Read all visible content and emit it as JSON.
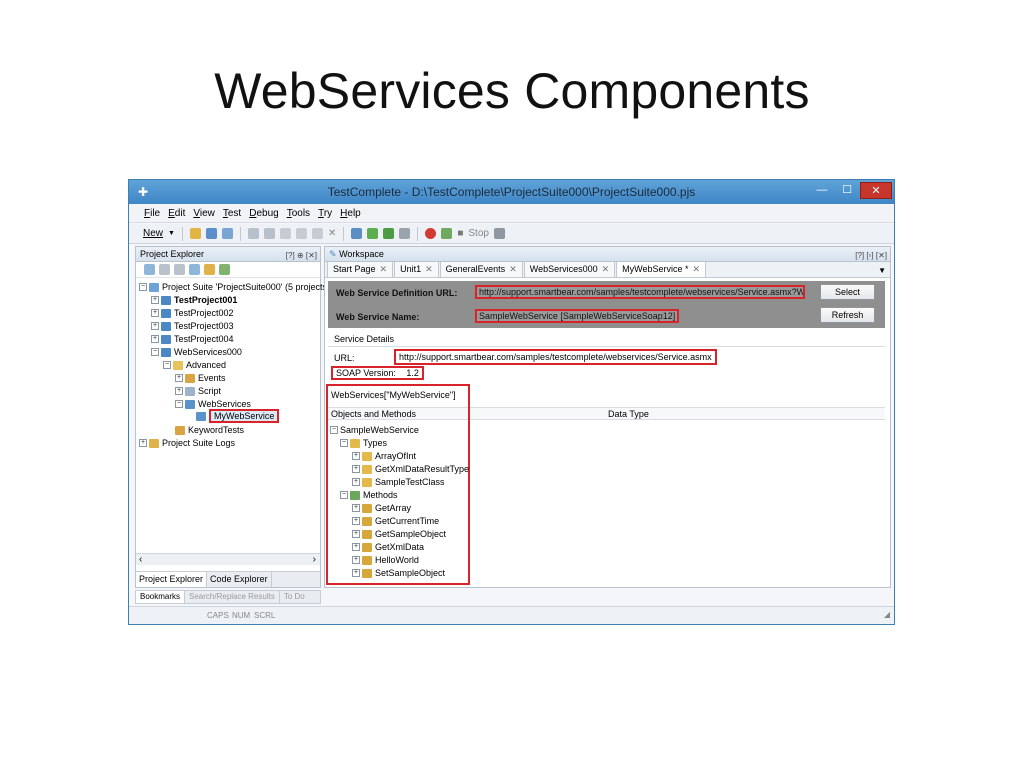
{
  "slide": {
    "title": "WebServices Components"
  },
  "window": {
    "title": "TestComplete - D:\\TestComplete\\ProjectSuite000\\ProjectSuite000.pjs",
    "min": "—",
    "max": "☐",
    "close": "✕"
  },
  "menu": [
    "File",
    "Edit",
    "View",
    "Test",
    "Debug",
    "Tools",
    "Try",
    "Help"
  ],
  "toolbar": {
    "new_label": "New",
    "stop_label": "Stop"
  },
  "project_explorer": {
    "title": "Project Explorer",
    "tree": [
      {
        "label": "Project Suite 'ProjectSuite000' (5 projects",
        "bold": false
      },
      {
        "label": "TestProject001",
        "bold": true
      },
      {
        "label": "TestProject002",
        "bold": false
      },
      {
        "label": "TestProject003",
        "bold": false
      },
      {
        "label": "TestProject004",
        "bold": false
      },
      {
        "label": "WebServices000",
        "bold": false
      },
      {
        "label": "Advanced",
        "bold": false
      },
      {
        "label": "Events",
        "bold": false
      },
      {
        "label": "Script",
        "bold": false
      },
      {
        "label": "WebServices",
        "bold": false
      },
      {
        "label": "MyWebService",
        "bold": false
      },
      {
        "label": "KeywordTests",
        "bold": false
      },
      {
        "label": "Project Suite Logs",
        "bold": false
      }
    ],
    "tabs": [
      "Project Explorer",
      "Code Explorer"
    ]
  },
  "bottom_tabs": [
    "Bookmarks",
    "Search/Replace Results",
    "To Do"
  ],
  "status": [
    "CAPS",
    "NUM",
    "SCRL"
  ],
  "workspace": {
    "title": "Workspace",
    "tabs": [
      {
        "label": "Start Page",
        "active": false
      },
      {
        "label": "Unit1",
        "active": false
      },
      {
        "label": "GeneralEvents",
        "active": false
      },
      {
        "label": "WebServices000",
        "active": false
      },
      {
        "label": "MyWebService *",
        "active": true
      }
    ],
    "definition_url_label": "Web Service Definition URL:",
    "definition_url": "http://support.smartbear.com/samples/testcomplete/webservices/Service.asmx?WSDL",
    "service_name_label": "Web Service Name:",
    "service_name": "SampleWebService [SampleWebServiceSoap12]",
    "select_button": "Select",
    "refresh_button": "Refresh",
    "details_label": "Service Details",
    "url_label": "URL:",
    "url": "http://support.smartbear.com/samples/testcomplete/webservices/Service.asmx",
    "soap_label": "SOAP Version:",
    "soap_version": "1.2",
    "object_path": "WebServices[\"MyWebService\"]",
    "col_objects": "Objects and Methods",
    "col_type": "Data Type",
    "objects": [
      {
        "label": "SampleWebService",
        "level": 0,
        "kind": "service"
      },
      {
        "label": "Types",
        "level": 1,
        "kind": "folder"
      },
      {
        "label": "ArrayOfInt",
        "level": 2,
        "kind": "type"
      },
      {
        "label": "GetXmlDataResultType",
        "level": 2,
        "kind": "type"
      },
      {
        "label": "SampleTestClass",
        "level": 2,
        "kind": "type"
      },
      {
        "label": "Methods",
        "level": 1,
        "kind": "folder"
      },
      {
        "label": "GetArray",
        "level": 2,
        "kind": "method"
      },
      {
        "label": "GetCurrentTime",
        "level": 2,
        "kind": "method"
      },
      {
        "label": "GetSampleObject",
        "level": 2,
        "kind": "method"
      },
      {
        "label": "GetXmlData",
        "level": 2,
        "kind": "method"
      },
      {
        "label": "HelloWorld",
        "level": 2,
        "kind": "method"
      },
      {
        "label": "SetSampleObject",
        "level": 2,
        "kind": "method"
      }
    ]
  },
  "colors": {
    "highlight": "#d8232a",
    "titlebar": "#4a90cf",
    "definition_bg": "#8f8f8f"
  }
}
